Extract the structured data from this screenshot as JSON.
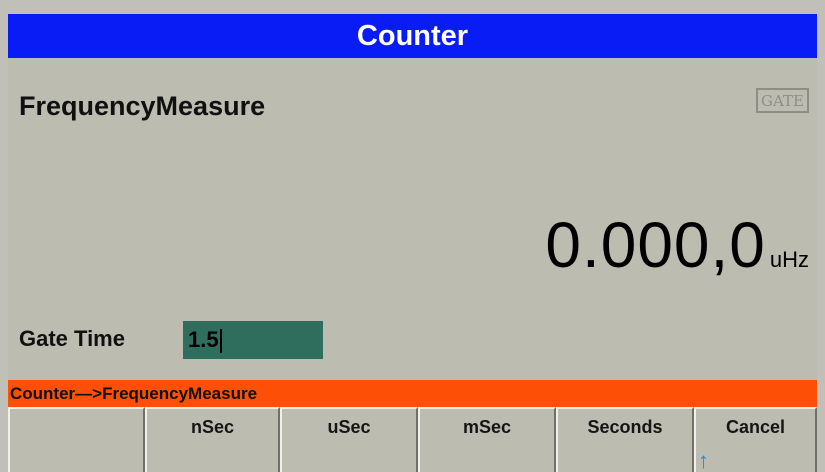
{
  "title": "Counter",
  "mode_title": "FrequencyMeasure",
  "gate_indicator": "GATE",
  "reading": {
    "value": "0.000,0",
    "unit": "uHz"
  },
  "gate_time": {
    "label": "Gate Time",
    "value": "1.5"
  },
  "status_bar": "Counter—>FrequencyMeasure",
  "softkeys": [
    {
      "label": ""
    },
    {
      "label": "nSec"
    },
    {
      "label": "uSec"
    },
    {
      "label": "mSec"
    },
    {
      "label": "Seconds"
    },
    {
      "label": "Cancel",
      "icon": "up-arrow-icon",
      "icon_glyph": "↑"
    }
  ],
  "colors": {
    "title_bar": "#0a1cf5",
    "status_bar": "#fd4f05",
    "input_field": "#2f6e5d",
    "arrow": "#1a8de6"
  }
}
